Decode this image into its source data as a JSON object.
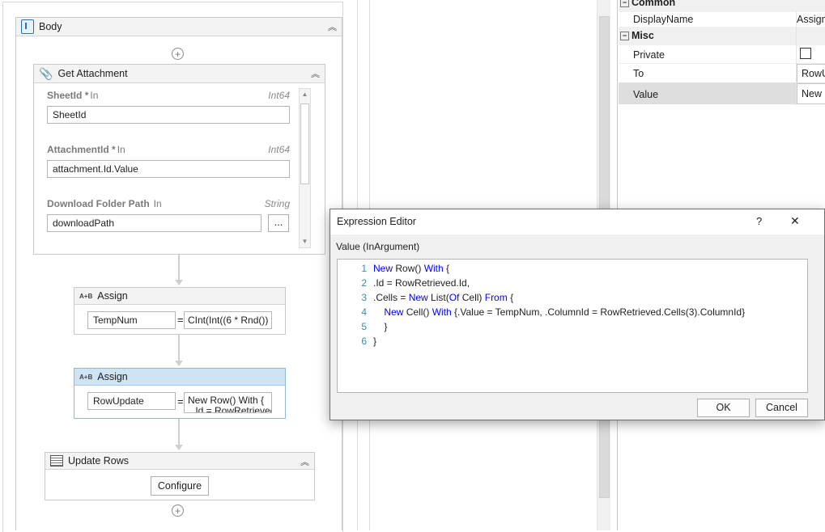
{
  "body_activity": {
    "title": "Body"
  },
  "get_attachment": {
    "title": "Get Attachment",
    "fields": [
      {
        "label": "SheetId",
        "required": "*",
        "direction": "In",
        "type": "Int64",
        "value": "SheetId"
      },
      {
        "label": "AttachmentId",
        "required": "*",
        "direction": "In",
        "type": "Int64",
        "value": "attachment.Id.Value"
      },
      {
        "label": "Download Folder Path",
        "required": "",
        "direction": "In",
        "type": "String",
        "value": "downloadPath",
        "browse_label": "..."
      }
    ]
  },
  "assign1": {
    "title": "Assign",
    "to": "TempNum",
    "eq": "=",
    "value": "CInt(Int((6 * Rnd())"
  },
  "assign2": {
    "title": "Assign",
    "to": "RowUpdate",
    "eq": "=",
    "value": "New Row() With {",
    "value_line2": ".Id = RowRetrieved.Id,"
  },
  "update_rows": {
    "title": "Update Rows",
    "configure_label": "Configure"
  },
  "properties": {
    "common_header": "Common",
    "displayname_label": "DisplayName",
    "displayname_value": "Assign",
    "misc_header": "Misc",
    "private_label": "Private",
    "to_label": "To",
    "to_value": "RowUpdate",
    "value_label": "Value",
    "value_value": "New Row"
  },
  "expression_editor": {
    "title": "Expression Editor",
    "help": "?",
    "close": "✕",
    "subtitle": "Value (InArgument)",
    "ok_label": "OK",
    "cancel_label": "Cancel",
    "lines": [
      {
        "n": "1",
        "html": "<span class=\"kw\">New</span> Row() <span class=\"kw\">With</span> {"
      },
      {
        "n": "2",
        "html": ".Id = RowRetrieved.Id,"
      },
      {
        "n": "3",
        "html": ".Cells = <span class=\"kw\">New</span> List(<span class=\"kw\">Of</span> Cell) <span class=\"kw\">From</span> {"
      },
      {
        "n": "4",
        "html": "    <span class=\"kw\">New</span> Cell() <span class=\"kw\">With</span> {.Value = TempNum, .ColumnId = RowRetrieved.Cells(3).ColumnId}"
      },
      {
        "n": "5",
        "html": "    }"
      },
      {
        "n": "6",
        "html": "}"
      }
    ]
  }
}
